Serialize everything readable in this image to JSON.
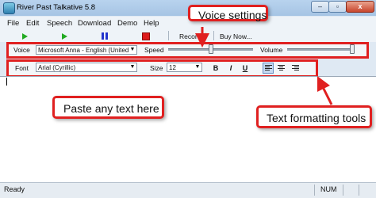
{
  "window": {
    "title": "River Past Talkative 5.8",
    "minimize_glyph": "–",
    "maximize_glyph": "▫",
    "close_glyph": "x"
  },
  "menu": [
    "File",
    "Edit",
    "Speech",
    "Download",
    "Demo",
    "Help"
  ],
  "toolbar": {
    "record_label": "Record",
    "buy_label": "Buy Now..."
  },
  "voice_bar": {
    "voice_label": "Voice",
    "voice_value": "Microsoft Anna - English (United",
    "speed_label": "Speed",
    "volume_label": "Volume",
    "speed_level": 0.5,
    "volume_level": 1.0
  },
  "font_bar": {
    "font_label": "Font",
    "font_value": "Arial (Cyrillic)",
    "size_label": "Size",
    "size_value": "12",
    "bold_glyph": "B",
    "italic_glyph": "I",
    "underline_glyph": "U"
  },
  "callouts": {
    "voice_settings": "Voice settings",
    "paste_text": "Paste any text here",
    "text_formatting": "Text formatting tools"
  },
  "status": {
    "ready": "Ready",
    "num": "NUM"
  },
  "colors": {
    "callout_border": "#e02020",
    "play": "#22aa22",
    "pause": "#2233cc",
    "stop": "#dd1b1b"
  }
}
